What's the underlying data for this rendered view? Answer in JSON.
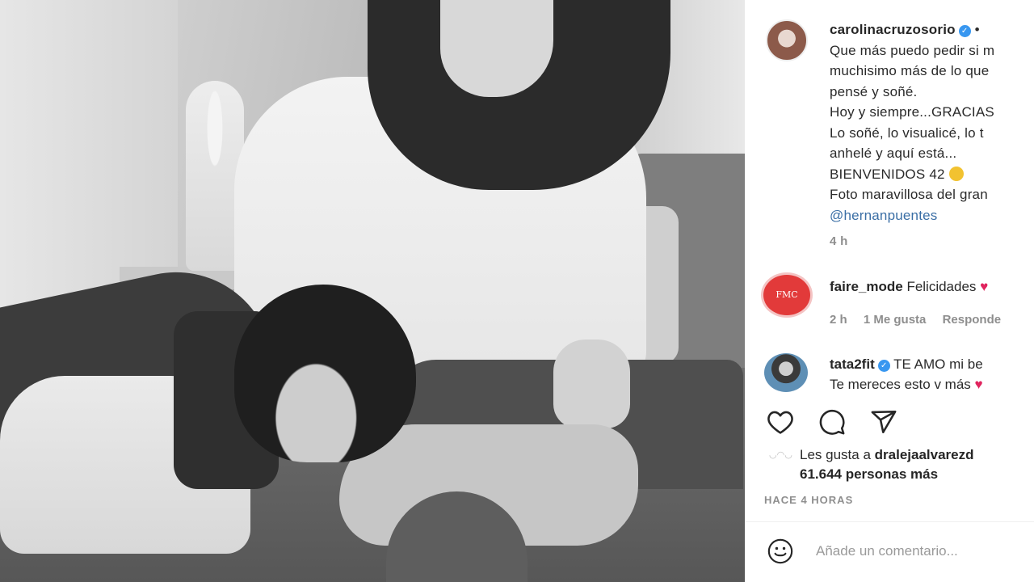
{
  "post": {
    "username": "carolinacruzosorio",
    "more_dot": "•",
    "caption_lines": [
      "Que más puedo pedir si m",
      "muchisimo más de lo que",
      "pensé y soñé.",
      "Hoy y siempre...GRACIAS",
      "Lo soñé, lo visualicé, lo t",
      "anhelé y aquí está...",
      "BIENVENIDOS 42",
      "Foto maravillosa del gran"
    ],
    "mention": "@hernanpuentes",
    "time": "4 h"
  },
  "comments": [
    {
      "username": "faire_mode",
      "text": "Felicidades",
      "avatar_text": "FMC",
      "time": "2 h",
      "likes": "1 Me gusta",
      "reply": "Responde"
    },
    {
      "username": "tata2fit",
      "text": "TE AMO mi be",
      "text_line2": "Te mereces esto v más"
    }
  ],
  "actions": {
    "like_icon": "heart-outline-icon",
    "comment_icon": "comment-bubble-icon",
    "share_icon": "paper-plane-icon"
  },
  "likes": {
    "prefix": "Les gusta a",
    "user": "dralejaalvarezd",
    "count_line": "61.644 personas más"
  },
  "posted_ago": "HACE 4 HORAS",
  "comment_box": {
    "placeholder": "Añade un comentario..."
  },
  "colors": {
    "verified": "#3897f0",
    "heart": "#e0245e",
    "mention": "#3a6ea5"
  }
}
